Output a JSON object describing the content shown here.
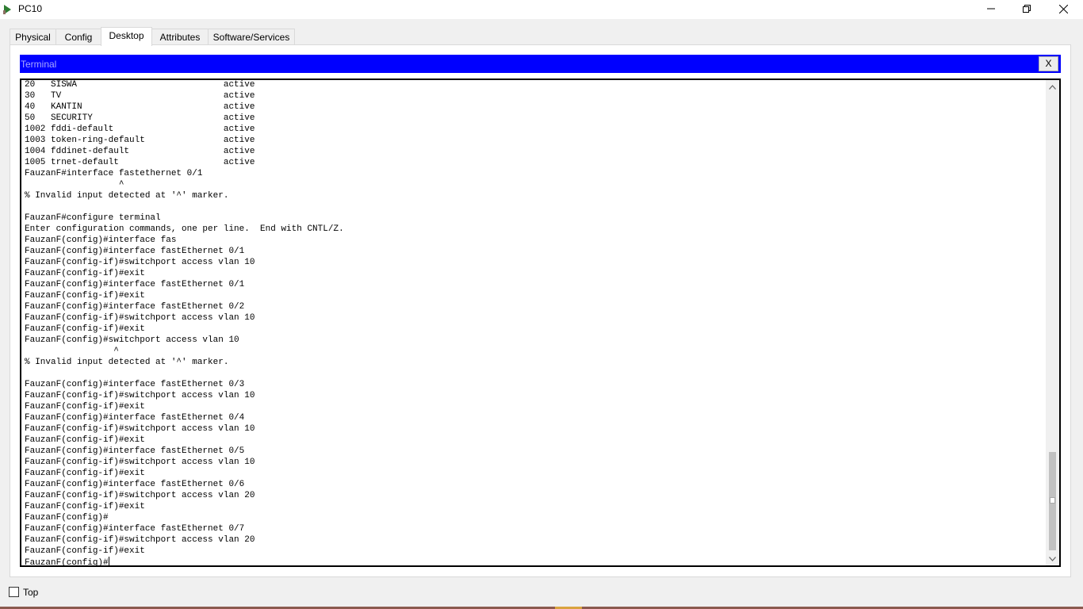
{
  "window": {
    "title": "PC10"
  },
  "tabs": [
    {
      "label": "Physical",
      "active": false
    },
    {
      "label": "Config",
      "active": false
    },
    {
      "label": "Desktop",
      "active": true
    },
    {
      "label": "Attributes",
      "active": false
    },
    {
      "label": "Software/Services",
      "active": false
    }
  ],
  "terminal": {
    "title": "Terminal",
    "close_label": "X",
    "lines": [
      "20   SISWA                            active",
      "30   TV                               active",
      "40   KANTIN                           active",
      "50   SECURITY                         active",
      "1002 fddi-default                     active",
      "1003 token-ring-default               active",
      "1004 fddinet-default                  active",
      "1005 trnet-default                    active",
      "FauzanF#interface fastethernet 0/1",
      "                  ^",
      "% Invalid input detected at '^' marker.",
      "",
      "FauzanF#configure terminal",
      "Enter configuration commands, one per line.  End with CNTL/Z.",
      "FauzanF(config)#interface fas",
      "FauzanF(config)#interface fastEthernet 0/1",
      "FauzanF(config-if)#switchport access vlan 10",
      "FauzanF(config-if)#exit",
      "FauzanF(config)#interface fastEthernet 0/1",
      "FauzanF(config-if)#exit",
      "FauzanF(config)#interface fastEthernet 0/2",
      "FauzanF(config-if)#switchport access vlan 10",
      "FauzanF(config-if)#exit",
      "FauzanF(config)#switchport access vlan 10",
      "                 ^",
      "% Invalid input detected at '^' marker.",
      "",
      "FauzanF(config)#interface fastEthernet 0/3",
      "FauzanF(config-if)#switchport access vlan 10",
      "FauzanF(config-if)#exit",
      "FauzanF(config)#interface fastEthernet 0/4",
      "FauzanF(config-if)#switchport access vlan 10",
      "FauzanF(config-if)#exit",
      "FauzanF(config)#interface fastEthernet 0/5",
      "FauzanF(config-if)#switchport access vlan 10",
      "FauzanF(config-if)#exit",
      "FauzanF(config)#interface fastEthernet 0/6",
      "FauzanF(config-if)#switchport access vlan 20",
      "FauzanF(config-if)#exit",
      "FauzanF(config)#",
      "FauzanF(config)#interface fastEthernet 0/7",
      "FauzanF(config-if)#switchport access vlan 20",
      "FauzanF(config-if)#exit"
    ],
    "prompt": "FauzanF(config)#"
  },
  "footer": {
    "top_label": "Top",
    "top_checked": false
  },
  "colors": {
    "terminal_header": "#0000ff",
    "terminal_title": "#a8a8ff"
  },
  "icons": [
    "app-icon",
    "minimize-icon",
    "maximize-icon",
    "close-icon",
    "scroll-up-icon",
    "scroll-down-icon"
  ]
}
